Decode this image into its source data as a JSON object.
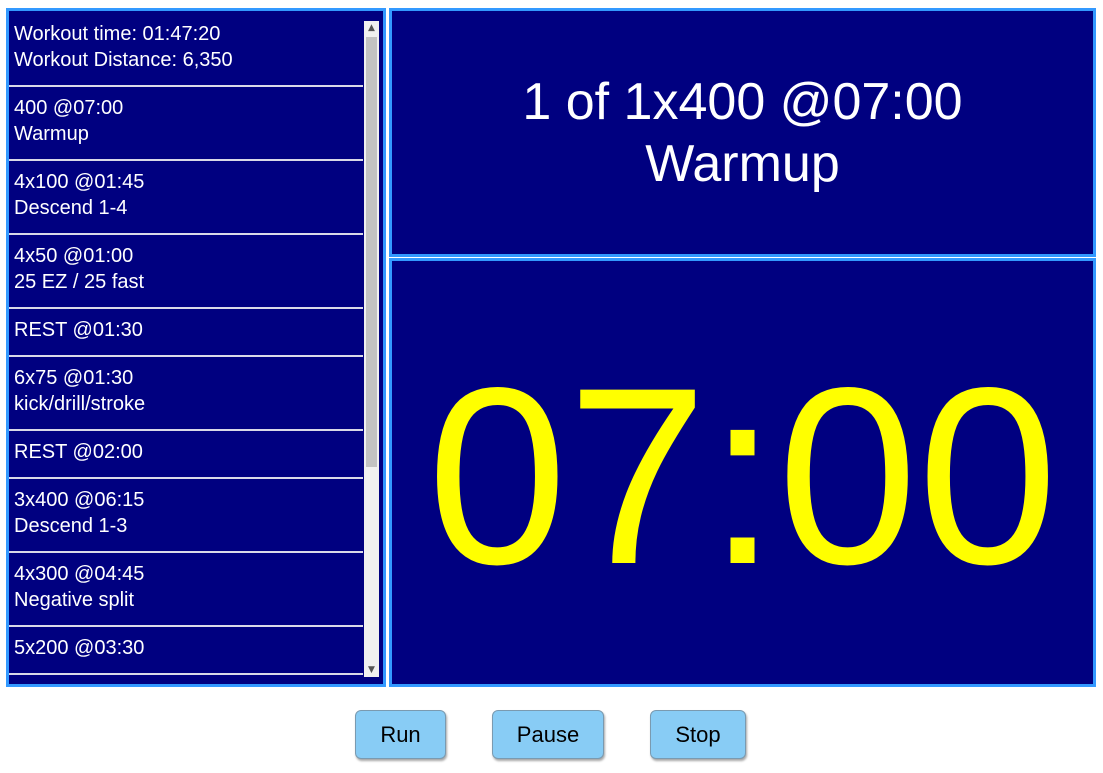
{
  "summary": {
    "time_line": "Workout time: 01:47:20",
    "distance_line": "Workout Distance: 6,350"
  },
  "sets": [
    {
      "line1": "400 @07:00",
      "line2": "Warmup"
    },
    {
      "line1": "4x100 @01:45",
      "line2": "Descend 1-4"
    },
    {
      "line1": "4x50 @01:00",
      "line2": "25 EZ / 25 fast"
    },
    {
      "line1": "REST @01:30",
      "line2": ""
    },
    {
      "line1": "6x75 @01:30",
      "line2": "kick/drill/stroke"
    },
    {
      "line1": "REST @02:00",
      "line2": ""
    },
    {
      "line1": "3x400 @06:15",
      "line2": "Descend 1-3"
    },
    {
      "line1": "4x300 @04:45",
      "line2": "Negative split"
    },
    {
      "line1": "5x200 @03:30",
      "line2": ""
    }
  ],
  "current": {
    "title": "1 of 1x400 @07:00",
    "subtitle": "Warmup",
    "timer": "07:00"
  },
  "controls": {
    "run_label": "Run",
    "pause_label": "Pause",
    "stop_label": "Stop"
  },
  "colors": {
    "panel_bg": "#000080",
    "panel_border": "#3399ff",
    "timer_text": "#ffff00",
    "button_bg": "#88ccf5"
  }
}
